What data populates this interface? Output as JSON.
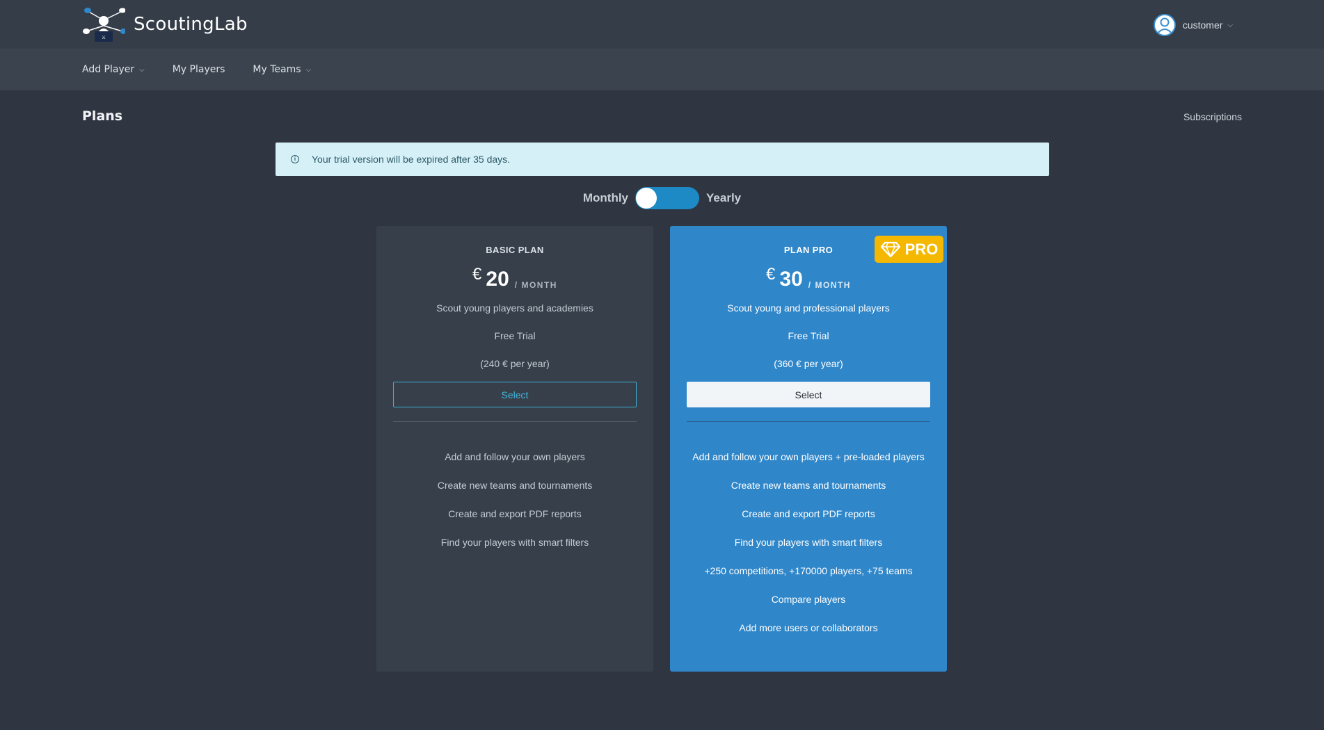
{
  "app": {
    "brand": "ScoutingLab",
    "user_name": "customer"
  },
  "nav": {
    "items": [
      {
        "label": "Add Player",
        "has_dropdown": true
      },
      {
        "label": "My Players",
        "has_dropdown": false
      },
      {
        "label": "My Teams",
        "has_dropdown": true
      }
    ]
  },
  "page": {
    "title": "Plans",
    "subscriptions_link": "Subscriptions"
  },
  "alert": {
    "message": "Your trial version will be expired after 35 days."
  },
  "billing_toggle": {
    "left_label": "Monthly",
    "right_label": "Yearly",
    "selected": "Monthly"
  },
  "plans": [
    {
      "name": "BASIC PLAN",
      "currency": "€",
      "amount": "20",
      "period": "/ MONTH",
      "description": "Scout young players and academies",
      "trial": "Free Trial",
      "yearly_note": "(240 € per year)",
      "select_label": "Select",
      "features": [
        "Add and follow your own players",
        "Create new teams and tournaments",
        "Create and export PDF reports",
        "Find your players with smart filters"
      ]
    },
    {
      "name": "PLAN PRO",
      "badge": "PRO",
      "currency": "€",
      "amount": "30",
      "period": "/ MONTH",
      "description": "Scout young and professional players",
      "trial": "Free Trial",
      "yearly_note": "(360 € per year)",
      "select_label": "Select",
      "features": [
        "Add and follow your own players + pre-loaded players",
        "Create new teams and tournaments",
        "Create and export PDF reports",
        "Find your players with smart filters",
        "+250 competitions, +170000 players, +75 teams",
        "Compare players",
        "Add more users or collaborators"
      ]
    }
  ],
  "colors": {
    "background": "#2f3641",
    "topbar": "#353d48",
    "navbar": "#3a434e",
    "pro_card": "#2f86c9",
    "basic_card": "#363f4a",
    "badge": "#f5b800",
    "toggle": "#1d8ac6",
    "alert_bg": "#d6f0f7"
  }
}
